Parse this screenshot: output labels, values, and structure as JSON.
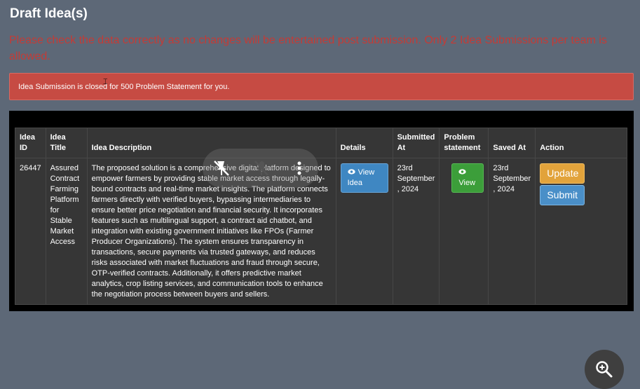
{
  "page": {
    "title": "Draft Idea(s)",
    "warning": "Please check the data correctly as no changes will be entertained post submission. Only 2 Idea Submissions per team is allowed.",
    "alert": "Idea Submission is closed for 500 Problem Statement for you."
  },
  "table": {
    "headers": {
      "id": "Idea ID",
      "title": "Idea Title",
      "description": "Idea Description",
      "details": "Details",
      "submitted_at": "Submitted At",
      "problem_statement": "Problem statement",
      "saved_at": "Saved At",
      "action": "Action"
    },
    "rows": [
      {
        "id": "26447",
        "title": "Assured Contract Farming Platform for Stable Market Access",
        "description": "The proposed solution is a comprehensive digital platform designed to empower farmers by providing stable market access through legally-bound contracts and real-time market insights. The platform connects farmers directly with verified buyers, bypassing intermediaries to ensure better price negotiation and financial security. It incorporates features such as multilingual support, a contract aid chatbot, and integration with existing government initiatives like FPOs (Farmer Producer Organizations). The system ensures transparency in transactions, secure payments via trusted gateways, and reduces risks associated with market fluctuations and fraud through secure, OTP-verified contracts. Additionally, it offers predictive market analytics, crop listing services, and communication tools to enhance the negotiation process between buyers and sellers.",
        "view_idea_label": "View Idea",
        "submitted_at": "23rd September , 2024",
        "view_label": "View",
        "saved_at": "23rd September , 2024",
        "update_label": "Update",
        "submit_label": "Submit"
      }
    ]
  },
  "icons": {
    "eye": "eye-icon",
    "overlay": [
      "pin-off-icon",
      "mute-icon",
      "more-vertical-icon"
    ],
    "zoom": "zoom-in-icon"
  },
  "colors": {
    "background": "#5d6877",
    "warning_text": "#c43b36",
    "alert_bg": "#c64b43",
    "table_bg": "#363636",
    "btn_primary": "#3f87c2",
    "btn_success": "#3c9e3a",
    "btn_warning": "#e2a33b"
  }
}
